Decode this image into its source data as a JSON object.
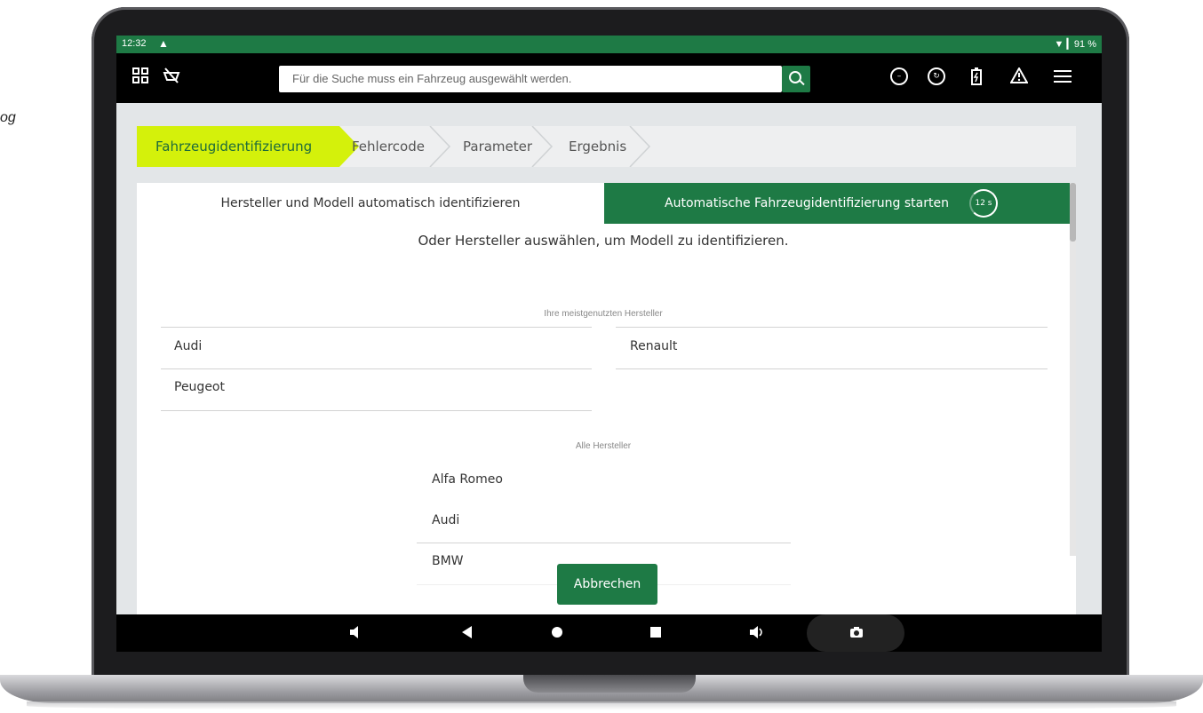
{
  "side_text": "og",
  "status_bar": {
    "time": "12:32",
    "battery": "▼ ▎91 %"
  },
  "top_bar": {
    "search_placeholder": "Für die Suche muss ein Fahrzeug ausgewählt werden.",
    "icons": [
      "grid-icon",
      "no-connection-icon",
      "search-icon",
      "stop-icon",
      "speed-icon",
      "battery-icon",
      "warning-icon",
      "menu-icon"
    ]
  },
  "breadcrumb": {
    "steps": [
      "Fahrzeugidentifizierung",
      "Fehlercode",
      "Parameter",
      "Ergebnis"
    ]
  },
  "auto_identify": {
    "label": "Hersteller und Modell automatisch identifizieren",
    "button": "Automatische Fahrzeugidentifizierung starten",
    "timer": "12 s"
  },
  "subtitle": "Oder Hersteller auswählen, um Modell zu identifizieren.",
  "frequent": {
    "label": "Ihre meistgenutzten Hersteller",
    "items": [
      "Audi",
      "Renault",
      "Peugeot"
    ]
  },
  "all": {
    "label": "Alle Hersteller",
    "items": [
      "Alfa Romeo",
      "Audi",
      "BMW"
    ]
  },
  "cancel_label": "Abbrechen",
  "colors": {
    "accent": "#1e7a45",
    "active_step": "#d4f10b"
  }
}
